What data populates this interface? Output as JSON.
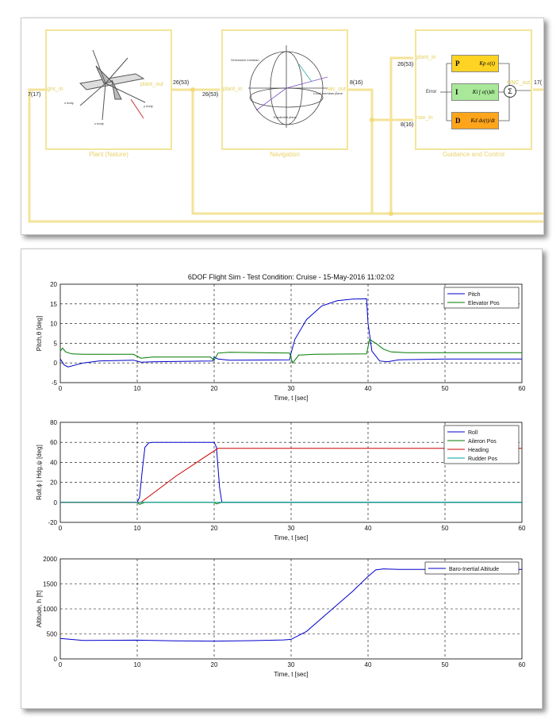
{
  "diagram": {
    "blocks": {
      "plant": {
        "title": "Plant (Nature)",
        "in_port": "gnc_in",
        "out_port": "plant_out"
      },
      "navigation": {
        "title": "Navigation",
        "in_port": "plant_in",
        "out_port": "nav_out"
      },
      "gnc": {
        "title": "Guidance and Control",
        "in_port_1": "plant_in",
        "in_port_2": "nav_in",
        "out_port": "GNC_out"
      }
    },
    "signals": {
      "gnc_in_dim": "7(17)",
      "plant_out_dim": "26(53)",
      "plant_to_nav_dim": "26(53)",
      "nav_out_dim": "8(16)",
      "gnc_plant_in_dim": "26(53)",
      "gnc_nav_in_dim": "8(16)",
      "gnc_out_dim": "17("
    },
    "pid": {
      "p": "P",
      "i": "I",
      "d": "D",
      "p_expr": "Kp e(t)",
      "i_expr": "Ki ∫ e(τ)dτ",
      "d_expr": "Kd de(t)/dt",
      "error_label": "Error",
      "sum_symbol": "Σ"
    },
    "figure_labels": {
      "sphere_1": "Greenwich meridian",
      "sphere_2": "Local meridian plane",
      "sphere_3": "Equatorial plane"
    }
  },
  "plots": {
    "title": "6DOF Flight Sim - Test Condition: Cruise - 15-May-2016 11:02:02"
  },
  "chart_data": [
    {
      "type": "line",
      "xlabel": "Time, t [sec]",
      "ylabel": "Pitch,θ [deg]",
      "xlim": [
        0,
        60
      ],
      "ylim": [
        -5,
        20
      ],
      "xticks": [
        "0",
        "10",
        "20",
        "30",
        "40",
        "50",
        "60"
      ],
      "yticks": [
        "-5",
        "0",
        "5",
        "10",
        "15",
        "20"
      ],
      "grid": true,
      "legend_position": "top-right",
      "series": [
        {
          "name": "Pitch",
          "color": "#0000cc",
          "x": [
            0,
            0.5,
            1,
            3,
            5,
            9.5,
            10.5,
            12,
            19.8,
            20,
            20.5,
            22,
            29.8,
            30,
            30.5,
            32,
            34,
            36,
            38,
            39.8,
            40,
            40.5,
            41.5,
            42.5,
            44,
            50,
            60
          ],
          "y": [
            1,
            -0.5,
            -1,
            0,
            0.5,
            0.7,
            0.2,
            0.3,
            0.5,
            1.5,
            1,
            0.7,
            0.8,
            2.5,
            6,
            11,
            14.5,
            15.8,
            16.2,
            16.3,
            10,
            3,
            0.5,
            0.3,
            0.8,
            1,
            1
          ]
        },
        {
          "name": "Elevator Pos",
          "color": "#007a00",
          "x": [
            0,
            0.3,
            0.7,
            1.5,
            3,
            9.5,
            10.5,
            12,
            19.5,
            20,
            20.5,
            22,
            29.8,
            30.2,
            31,
            33,
            39.8,
            40.2,
            41,
            42,
            43,
            45,
            60
          ],
          "y": [
            3,
            3.8,
            2.8,
            2.3,
            2.2,
            2.2,
            1.2,
            1.5,
            1.5,
            0.7,
            2.5,
            2.7,
            2.5,
            0,
            2,
            2.2,
            2.3,
            6,
            5,
            3.5,
            2.8,
            2.6,
            2.6
          ]
        }
      ]
    },
    {
      "type": "line",
      "xlabel": "Time, t [sec]",
      "ylabel": "Roll,ϕ | Hdg,ψ [deg]",
      "xlim": [
        0,
        60
      ],
      "ylim": [
        -20,
        80
      ],
      "xticks": [
        "0",
        "10",
        "20",
        "30",
        "40",
        "50",
        "60"
      ],
      "yticks": [
        "-20",
        "0",
        "20",
        "40",
        "60",
        "80"
      ],
      "grid": true,
      "legend_position": "top-right",
      "series": [
        {
          "name": "Roll",
          "color": "#0000cc",
          "x": [
            0,
            10,
            10.3,
            10.7,
            11,
            11.5,
            12,
            20,
            20.3,
            20.7,
            21,
            22,
            60
          ],
          "y": [
            0,
            0,
            5,
            35,
            55,
            59.5,
            60,
            60,
            55,
            15,
            0,
            0,
            0
          ]
        },
        {
          "name": "Aileron Pos",
          "color": "#007a00",
          "x": [
            0,
            10,
            10.3,
            11,
            20,
            20.3,
            21,
            60
          ],
          "y": [
            0,
            0,
            -2,
            0,
            0,
            -1.5,
            0,
            0
          ]
        },
        {
          "name": "Heading",
          "color": "#cc0000",
          "x": [
            0,
            10,
            10.5,
            15,
            20.5,
            21,
            60
          ],
          "y": [
            0,
            0,
            0,
            26,
            54,
            54,
            54
          ]
        },
        {
          "name": "Rudder Pos",
          "color": "#00a0a0",
          "x": [
            0,
            60
          ],
          "y": [
            0,
            0
          ]
        }
      ]
    },
    {
      "type": "line",
      "xlabel": "Time, t [sec]",
      "ylabel": "Altitude, h [ft]",
      "xlim": [
        0,
        60
      ],
      "ylim": [
        0,
        2000
      ],
      "xticks": [
        "0",
        "10",
        "20",
        "30",
        "40",
        "50",
        "60"
      ],
      "yticks": [
        "0",
        "500",
        "1000",
        "1500",
        "2000"
      ],
      "grid": true,
      "legend_position": "top-right",
      "series": [
        {
          "name": "Baro-Inertial Altitude",
          "color": "#0000cc",
          "x": [
            0,
            3,
            10,
            15,
            20,
            25,
            29,
            30,
            32,
            35,
            38,
            40,
            41,
            42,
            44,
            50,
            60
          ],
          "y": [
            410,
            370,
            375,
            360,
            355,
            365,
            380,
            390,
            550,
            950,
            1350,
            1650,
            1780,
            1800,
            1790,
            1790,
            1790
          ]
        }
      ]
    }
  ]
}
